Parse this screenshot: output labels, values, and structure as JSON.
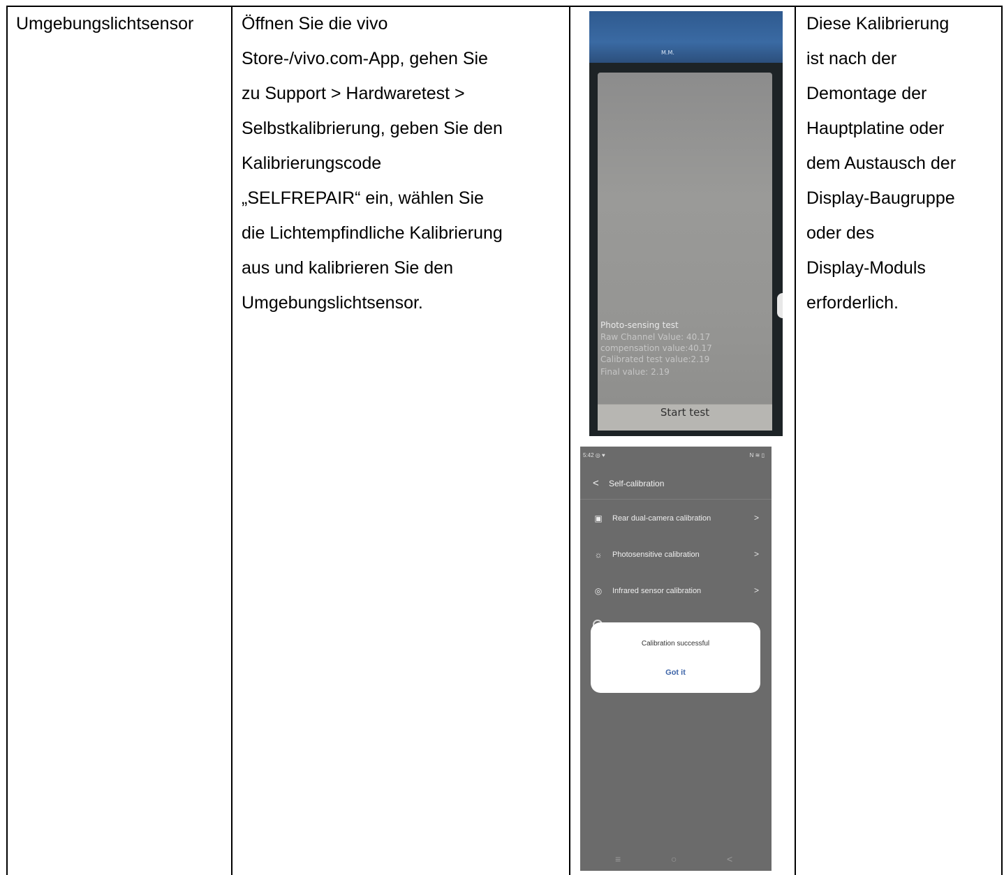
{
  "col1": {
    "text": "Umgebungslichtsensor"
  },
  "col2": {
    "lines": [
      "Öffnen Sie die vivo",
      "Store-/vivo.com-App, gehen Sie",
      "zu Support > Hardwaretest >",
      "Selbstkalibrierung, geben Sie den",
      "Kalibrierungscode",
      "„SELFREPAIR“ ein, wählen Sie",
      "die Lichtempfindliche Kalibrierung",
      "aus und kalibrieren Sie den",
      "Umgebungslichtsensor."
    ]
  },
  "col4": {
    "lines": [
      "Diese Kalibrierung",
      "ist nach der",
      "Demontage der",
      "Hauptplatine oder",
      "dem Austausch der",
      "Display-Baugruppe",
      "oder des",
      "Display-Moduls",
      "erforderlich."
    ]
  },
  "photo": {
    "tape_text": "M.M.",
    "test_title": "Photo-sensing test",
    "raw_value": "Raw Channel Value:  40.17",
    "compensation": "compensation value:40.17",
    "calibrated": "Calibrated test value:2.19",
    "final": "Final value:  2.19",
    "start_button": "Start test"
  },
  "app": {
    "time": "5:42 ◎ ♥",
    "status_icons": "N ≋ ▯",
    "back_glyph": "<",
    "title": "Self-calibration",
    "items": [
      {
        "icon": "camera-icon",
        "glyph": "▣",
        "label": "Rear dual-camera calibration",
        "chevron": ">"
      },
      {
        "icon": "sun-icon",
        "glyph": "☼",
        "label": "Photosensitive calibration",
        "chevron": ">"
      },
      {
        "icon": "target-icon",
        "glyph": "◎",
        "label": "Infrared sensor calibration",
        "chevron": ">"
      }
    ],
    "dialog": {
      "message": "Calibration successful",
      "button": "Got it"
    },
    "nav": {
      "menu": "≡",
      "home": "○",
      "back": "<"
    }
  }
}
